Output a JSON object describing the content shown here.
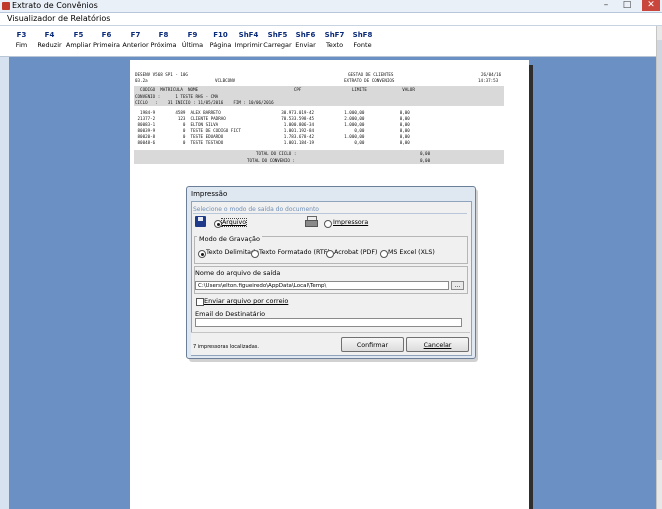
{
  "window": {
    "title": "Extrato de Convênios",
    "minimize": "–",
    "maximize": "□",
    "close": "✕"
  },
  "viewer": {
    "title": "Visualizador de Relatórios"
  },
  "toolbar": [
    {
      "key": "F3",
      "label": "Fim"
    },
    {
      "key": "F4",
      "label": "Reduzir"
    },
    {
      "key": "F5",
      "label": "Ampliar"
    },
    {
      "key": "F6",
      "label": "Primeira"
    },
    {
      "key": "F7",
      "label": "Anterior"
    },
    {
      "key": "F8",
      "label": "Próxima"
    },
    {
      "key": "F9",
      "label": "Última"
    },
    {
      "key": "F10",
      "label": "Página"
    },
    {
      "key": "ShF4",
      "label": "Imprimir"
    },
    {
      "key": "ShF5",
      "label": "Carregar"
    },
    {
      "key": "ShF6",
      "label": "Enviar"
    },
    {
      "key": "ShF7",
      "label": "Texto"
    },
    {
      "key": "ShF8",
      "label": "Fonte"
    }
  ],
  "report": {
    "header_left_1": "DESENV V568 SP1 - 10G",
    "header_left_2": "03.2a",
    "header_mid_2": "VCLBCONV",
    "header_title_1": "GESTAO DE CLIENTES",
    "header_title_2": "EXTRATO DE CONVENIOS",
    "header_date": "26/04/16",
    "header_time": "14:37:53",
    "columns": "  CODIGO  MATRICULA  NOME                                      CPF                    LIMITE              VALOR",
    "convenio_line": "CONVENIO :      1 TESTE RHS - CMA",
    "ciclo_line": "CICLO   :    31 INICIO : 11/05/2016    FIM : 10/06/2016",
    "rows": [
      "  1984-9        4589  ALEX BARRETO                        30.973.019-42            1.000,00              0,00",
      " 21377-2         123  CLIENTE PADRAO                      70.533.598-45            2.000,00              0,00",
      " 80083-1           0  ELTON SILVA                          1.000.806-34            1.000,00              0,00",
      " 80039-9           0  TESTE DE CODIGO FICT                 1.001.192-84                0,00              0,00",
      " 80020-8           0  TESTE EDUARDO                        1.783.678-42            1.000,00              0,00",
      " 80048-6           0  TESTE TESTADO                        1.001.184-19                0,00              0,00"
    ],
    "total_ciclo_label": "TOTAL DO CICLO :",
    "total_ciclo_value": "0,00",
    "total_convenio_label": "TOTAL DO CONVENIO :",
    "total_convenio_value": "0,00"
  },
  "dialog": {
    "title": "Impressão",
    "subtitle": "Selecione o modo de saída do documento",
    "opt_arquivo": "Arquivo",
    "opt_impressora": "Impressora",
    "modo_title": "Modo de Gravação",
    "modos": [
      "Texto Delimitado",
      "Texto Formatado (RTF)",
      "Acrobat (PDF)",
      "MS Excel (XLS)"
    ],
    "nome_label": "Nome do arquivo de saída",
    "nome_value": "C:\\Users\\elton.figueiredo\\AppData\\Local\\Temp\\",
    "browse": "...",
    "enviar_label": "Enviar arquivo por correio",
    "email_label": "Email do Destinatário",
    "email_value": "",
    "status": "7 impressoras localizadas.",
    "confirmar": "Confirmar",
    "cancelar": "Cancelar"
  }
}
